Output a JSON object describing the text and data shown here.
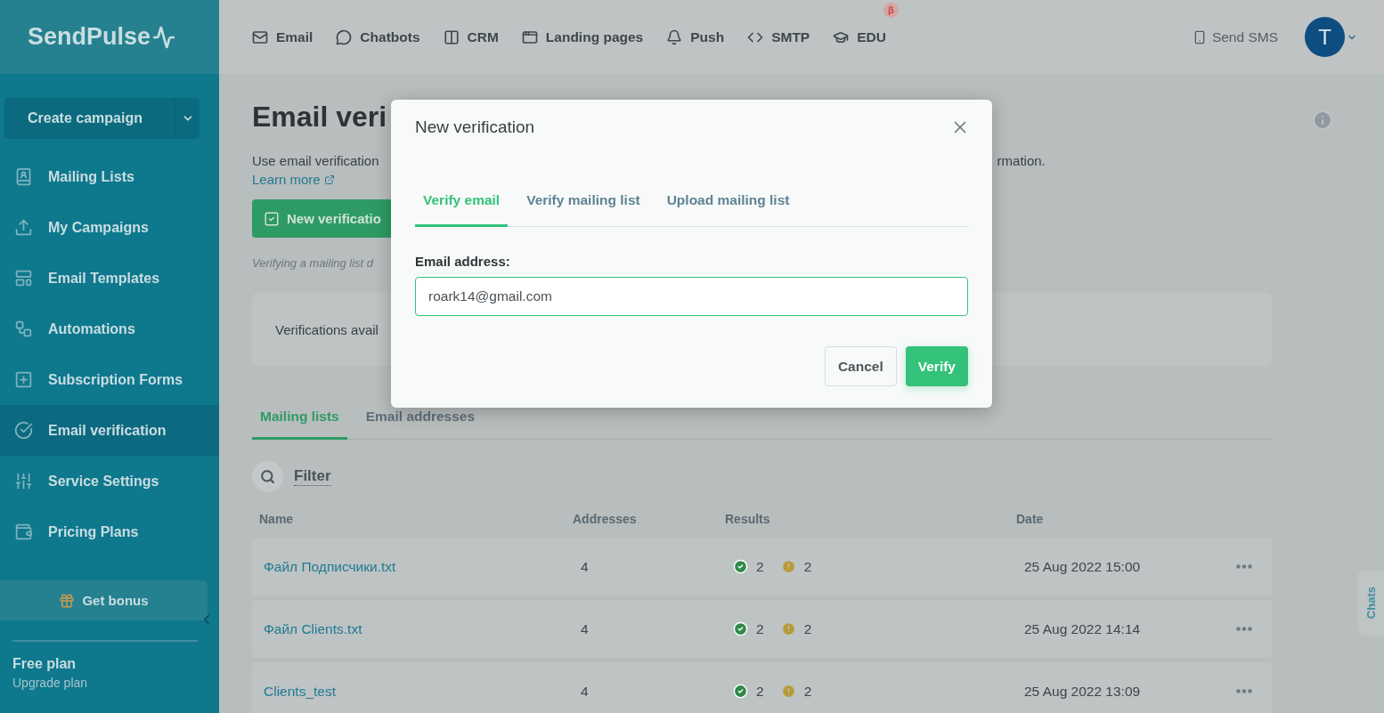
{
  "sidebar": {
    "logo": "SendPulse",
    "create_button": "Create campaign",
    "items": [
      {
        "label": "Mailing Lists",
        "selected": false
      },
      {
        "label": "My Campaigns",
        "selected": false
      },
      {
        "label": "Email Templates",
        "selected": false
      },
      {
        "label": "Automations",
        "selected": false
      },
      {
        "label": "Subscription Forms",
        "selected": false
      },
      {
        "label": "Email verification",
        "selected": true
      },
      {
        "label": "Service Settings",
        "selected": false
      },
      {
        "label": "Pricing Plans",
        "selected": false
      }
    ],
    "bonus_button": "Get bonus",
    "plan": {
      "title": "Free plan",
      "link": "Upgrade plan"
    }
  },
  "top_nav": {
    "items": [
      {
        "label": "Email"
      },
      {
        "label": "Chatbots"
      },
      {
        "label": "CRM"
      },
      {
        "label": "Landing pages"
      },
      {
        "label": "Push"
      },
      {
        "label": "SMTP"
      },
      {
        "label": "EDU",
        "badge": "β"
      }
    ],
    "send_sms": "Send SMS",
    "avatar": "T"
  },
  "page": {
    "title": "Email veri",
    "description": "Use email verification",
    "description_tail": "rmation.",
    "learn_more": "Learn more",
    "new_button": "New verificatio",
    "note": "Verifying a mailing list d",
    "card_text": "Verifications avail",
    "tabs": [
      {
        "label": "Mailing lists",
        "selected": true
      },
      {
        "label": "Email addresses",
        "selected": false
      }
    ],
    "filter": "Filter",
    "table": {
      "columns": [
        "Name",
        "Addresses",
        "Results",
        "Date"
      ],
      "rows": [
        {
          "name": "Файл Подписчики.txt",
          "addresses": "4",
          "valid": "2",
          "risky": "2",
          "date": "25 Aug 2022 15:00"
        },
        {
          "name": "Файл Clients.txt",
          "addresses": "4",
          "valid": "2",
          "risky": "2",
          "date": "25 Aug 2022 14:14"
        },
        {
          "name": "Clients_test",
          "addresses": "4",
          "valid": "2",
          "risky": "2",
          "date": "25 Aug 2022 13:09"
        }
      ]
    }
  },
  "chats_tab": "Chats",
  "modal": {
    "title": "New verification",
    "tabs": [
      {
        "label": "Verify email",
        "selected": true
      },
      {
        "label": "Verify mailing list",
        "selected": false
      },
      {
        "label": "Upload mailing list",
        "selected": false
      }
    ],
    "field_label": "Email address:",
    "field_value": "roark14@gmail.com",
    "cancel": "Cancel",
    "verify": "Verify"
  }
}
